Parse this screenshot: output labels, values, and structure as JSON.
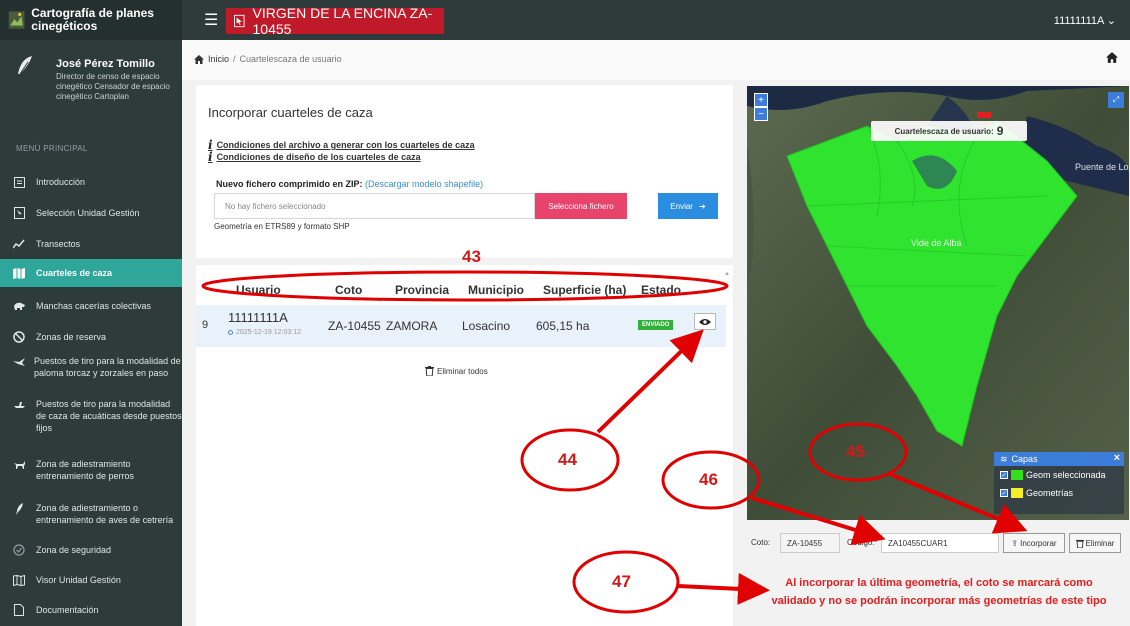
{
  "app": {
    "title": "Cartografía de planes cinegéticos",
    "unit_tag": "VIRGEN DE LA ENCINA ZA-10455",
    "user_menu": "11111111A ⌄"
  },
  "profile": {
    "name": "José Pérez Tomillo",
    "roles": "Director de censo de espacio cinegético Censador de espacio cinegético Cartoplan"
  },
  "sidebar": {
    "menu_title": "MENÚ PRINCIPAL",
    "items": [
      {
        "label": "Introducción",
        "icon": "document-icon"
      },
      {
        "label": "Selección Unidad Gestión",
        "icon": "cursor-icon"
      },
      {
        "label": "Transectos",
        "icon": "transect-icon"
      },
      {
        "label": "Cuarteles de caza",
        "icon": "map-icon"
      },
      {
        "label": "Manchas cacerías colectivas",
        "icon": "boar-icon"
      },
      {
        "label": "Zonas de reserva",
        "icon": "ban-icon"
      },
      {
        "label": "Puestos de tiro para la modalidad de paloma torcaz y zorzales en paso",
        "icon": "bird-icon"
      },
      {
        "label": "Puestos de tiro para la modalidad de caza de acuáticas desde puestos fijos",
        "icon": "duck-icon"
      },
      {
        "label": "Zona de adiestramiento entrenamiento de perros",
        "icon": "dog-icon"
      },
      {
        "label": "Zona de adiestramiento o entrenamiento de aves de cetrería",
        "icon": "feather-icon"
      },
      {
        "label": "Zona de seguridad",
        "icon": "check-circle-icon"
      },
      {
        "label": "Visor Unidad Gestión",
        "icon": "map-viewer-icon"
      },
      {
        "label": "Documentación",
        "icon": "file-icon"
      }
    ]
  },
  "breadcrumb": {
    "home": "Inicio",
    "separator": "/",
    "current": "Cuartelescaza de usuario"
  },
  "incorporar": {
    "title": "Incorporar cuarteles de caza",
    "cond_file": "Condiciones del archivo a generar con los cuarteles de caza",
    "cond_design": "Condiciones de diseño de los cuarteles de caza",
    "zip_label": "Nuevo fichero comprimido en ZIP:",
    "zip_link": "(Descargar modelo shapefile)",
    "file_placeholder": "No hay fichero seleccionado",
    "select_button": "Selecciona fichero",
    "send_button": "Enviar",
    "geo_note": "Geometría en ETRS89 y formato SHP"
  },
  "table": {
    "columns": [
      "Usuario",
      "Coto",
      "Provincia",
      "Municipio",
      "Superficie (ha)",
      "Estado"
    ],
    "row": {
      "num": "9",
      "user": "11111111A",
      "date": "2025-12-19 12:03:12",
      "coto": "ZA-10455",
      "provincia": "ZAMORA",
      "municipio": "Losacino",
      "superficie": "605,15 ha",
      "estado": "ENVIADO"
    },
    "delete_all": "Eliminar todos"
  },
  "map": {
    "title_label": "Cuartelescaza de usuario:",
    "count": "9",
    "place_1": "Puente de Lo",
    "place_2": "Vide de Alba",
    "zoom_in": "+",
    "zoom_out": "−",
    "layers_title": "Capas",
    "layer_1": "Geom seleccionada",
    "layer_2": "Geometrías",
    "layer_1_color": "#33e01a",
    "layer_2_color": "#f5ee2a"
  },
  "form": {
    "coto_label": "Coto:",
    "coto_value": "ZA-10455",
    "code_label": "Código:*",
    "code_value": "ZA10455CUAR1",
    "incorporar_button": "Incorporar",
    "eliminar_button": "Eliminar"
  },
  "warning": "Al incorporar la última geometría, el coto se marcará como validado y no se podrán incorporar más geometrías de este tipo",
  "annotations": [
    "43",
    "44",
    "45",
    "46",
    "47"
  ],
  "colors": {
    "accent_teal": "#2ea79a",
    "tag_red": "#c01a2a",
    "select_pink": "#e8436b",
    "send_blue": "#2b8de0",
    "annotation_red": "#d21919"
  }
}
